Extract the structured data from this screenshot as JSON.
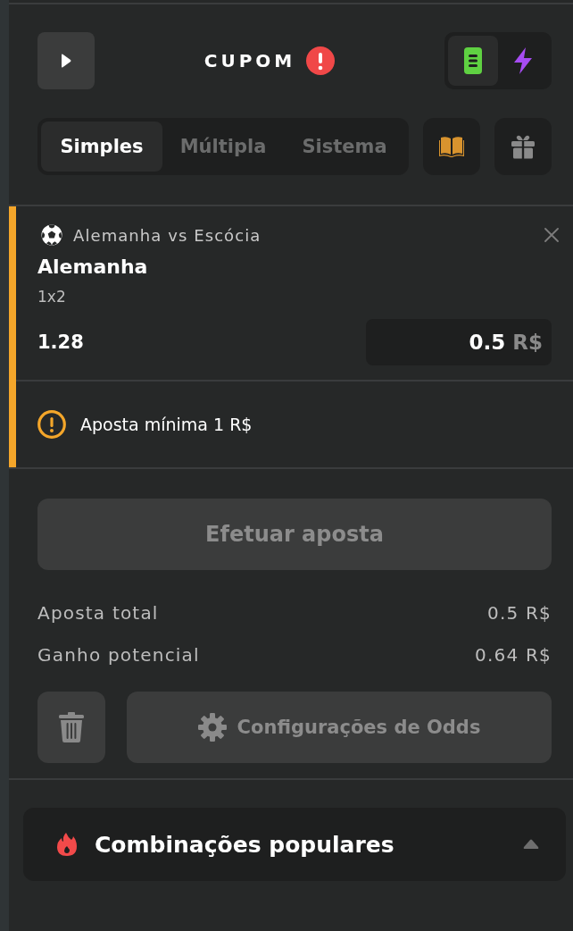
{
  "header": {
    "title": "CUPOM",
    "alert": true,
    "modes": [
      {
        "kind": "list",
        "selected": true
      },
      {
        "kind": "lightning",
        "selected": false
      }
    ]
  },
  "bet_types": {
    "tabs": [
      {
        "label": "Simples",
        "selected": true
      },
      {
        "label": "Múltipla",
        "selected": false
      },
      {
        "label": "Sistema",
        "selected": false
      }
    ]
  },
  "selection": {
    "match": "Alemanha vs Escócia",
    "pick": "Alemanha",
    "market": "1x2",
    "odds": "1.28",
    "stake": "0.5",
    "currency": "R$"
  },
  "warning": "Aposta mínima 1 R$",
  "place_bet": {
    "label": "Efetuar aposta",
    "disabled": true
  },
  "summary": [
    {
      "label": "Aposta total",
      "value": "0.5 R$"
    },
    {
      "label": "Ganho potencial",
      "value": "0.64 R$"
    }
  ],
  "odds_settings": {
    "label": "Configurações de Odds"
  },
  "popular": {
    "title": "Combinações populares",
    "expanded": false
  }
}
